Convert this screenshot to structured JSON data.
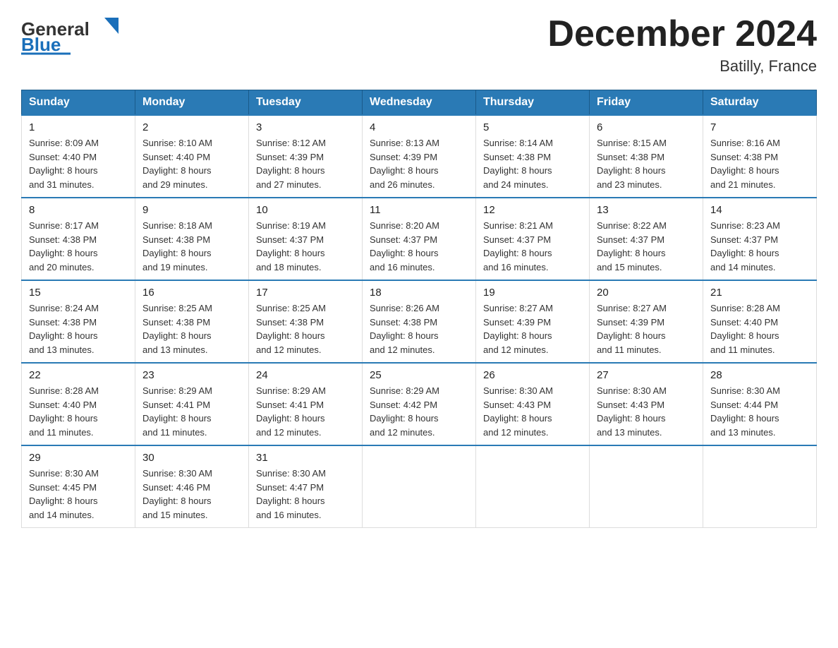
{
  "header": {
    "logo_general": "General",
    "logo_blue": "Blue",
    "month_title": "December 2024",
    "location": "Batilly, France"
  },
  "weekdays": [
    "Sunday",
    "Monday",
    "Tuesday",
    "Wednesday",
    "Thursday",
    "Friday",
    "Saturday"
  ],
  "weeks": [
    [
      {
        "day": "1",
        "sunrise": "8:09 AM",
        "sunset": "4:40 PM",
        "daylight_h": "8",
        "daylight_m": "31"
      },
      {
        "day": "2",
        "sunrise": "8:10 AM",
        "sunset": "4:40 PM",
        "daylight_h": "8",
        "daylight_m": "29"
      },
      {
        "day": "3",
        "sunrise": "8:12 AM",
        "sunset": "4:39 PM",
        "daylight_h": "8",
        "daylight_m": "27"
      },
      {
        "day": "4",
        "sunrise": "8:13 AM",
        "sunset": "4:39 PM",
        "daylight_h": "8",
        "daylight_m": "26"
      },
      {
        "day": "5",
        "sunrise": "8:14 AM",
        "sunset": "4:38 PM",
        "daylight_h": "8",
        "daylight_m": "24"
      },
      {
        "day": "6",
        "sunrise": "8:15 AM",
        "sunset": "4:38 PM",
        "daylight_h": "8",
        "daylight_m": "23"
      },
      {
        "day": "7",
        "sunrise": "8:16 AM",
        "sunset": "4:38 PM",
        "daylight_h": "8",
        "daylight_m": "21"
      }
    ],
    [
      {
        "day": "8",
        "sunrise": "8:17 AM",
        "sunset": "4:38 PM",
        "daylight_h": "8",
        "daylight_m": "20"
      },
      {
        "day": "9",
        "sunrise": "8:18 AM",
        "sunset": "4:38 PM",
        "daylight_h": "8",
        "daylight_m": "19"
      },
      {
        "day": "10",
        "sunrise": "8:19 AM",
        "sunset": "4:37 PM",
        "daylight_h": "8",
        "daylight_m": "18"
      },
      {
        "day": "11",
        "sunrise": "8:20 AM",
        "sunset": "4:37 PM",
        "daylight_h": "8",
        "daylight_m": "16"
      },
      {
        "day": "12",
        "sunrise": "8:21 AM",
        "sunset": "4:37 PM",
        "daylight_h": "8",
        "daylight_m": "16"
      },
      {
        "day": "13",
        "sunrise": "8:22 AM",
        "sunset": "4:37 PM",
        "daylight_h": "8",
        "daylight_m": "15"
      },
      {
        "day": "14",
        "sunrise": "8:23 AM",
        "sunset": "4:37 PM",
        "daylight_h": "8",
        "daylight_m": "14"
      }
    ],
    [
      {
        "day": "15",
        "sunrise": "8:24 AM",
        "sunset": "4:38 PM",
        "daylight_h": "8",
        "daylight_m": "13"
      },
      {
        "day": "16",
        "sunrise": "8:25 AM",
        "sunset": "4:38 PM",
        "daylight_h": "8",
        "daylight_m": "13"
      },
      {
        "day": "17",
        "sunrise": "8:25 AM",
        "sunset": "4:38 PM",
        "daylight_h": "8",
        "daylight_m": "12"
      },
      {
        "day": "18",
        "sunrise": "8:26 AM",
        "sunset": "4:38 PM",
        "daylight_h": "8",
        "daylight_m": "12"
      },
      {
        "day": "19",
        "sunrise": "8:27 AM",
        "sunset": "4:39 PM",
        "daylight_h": "8",
        "daylight_m": "12"
      },
      {
        "day": "20",
        "sunrise": "8:27 AM",
        "sunset": "4:39 PM",
        "daylight_h": "8",
        "daylight_m": "11"
      },
      {
        "day": "21",
        "sunrise": "8:28 AM",
        "sunset": "4:40 PM",
        "daylight_h": "8",
        "daylight_m": "11"
      }
    ],
    [
      {
        "day": "22",
        "sunrise": "8:28 AM",
        "sunset": "4:40 PM",
        "daylight_h": "8",
        "daylight_m": "11"
      },
      {
        "day": "23",
        "sunrise": "8:29 AM",
        "sunset": "4:41 PM",
        "daylight_h": "8",
        "daylight_m": "11"
      },
      {
        "day": "24",
        "sunrise": "8:29 AM",
        "sunset": "4:41 PM",
        "daylight_h": "8",
        "daylight_m": "12"
      },
      {
        "day": "25",
        "sunrise": "8:29 AM",
        "sunset": "4:42 PM",
        "daylight_h": "8",
        "daylight_m": "12"
      },
      {
        "day": "26",
        "sunrise": "8:30 AM",
        "sunset": "4:43 PM",
        "daylight_h": "8",
        "daylight_m": "12"
      },
      {
        "day": "27",
        "sunrise": "8:30 AM",
        "sunset": "4:43 PM",
        "daylight_h": "8",
        "daylight_m": "13"
      },
      {
        "day": "28",
        "sunrise": "8:30 AM",
        "sunset": "4:44 PM",
        "daylight_h": "8",
        "daylight_m": "13"
      }
    ],
    [
      {
        "day": "29",
        "sunrise": "8:30 AM",
        "sunset": "4:45 PM",
        "daylight_h": "8",
        "daylight_m": "14"
      },
      {
        "day": "30",
        "sunrise": "8:30 AM",
        "sunset": "4:46 PM",
        "daylight_h": "8",
        "daylight_m": "15"
      },
      {
        "day": "31",
        "sunrise": "8:30 AM",
        "sunset": "4:47 PM",
        "daylight_h": "8",
        "daylight_m": "16"
      },
      null,
      null,
      null,
      null
    ]
  ]
}
